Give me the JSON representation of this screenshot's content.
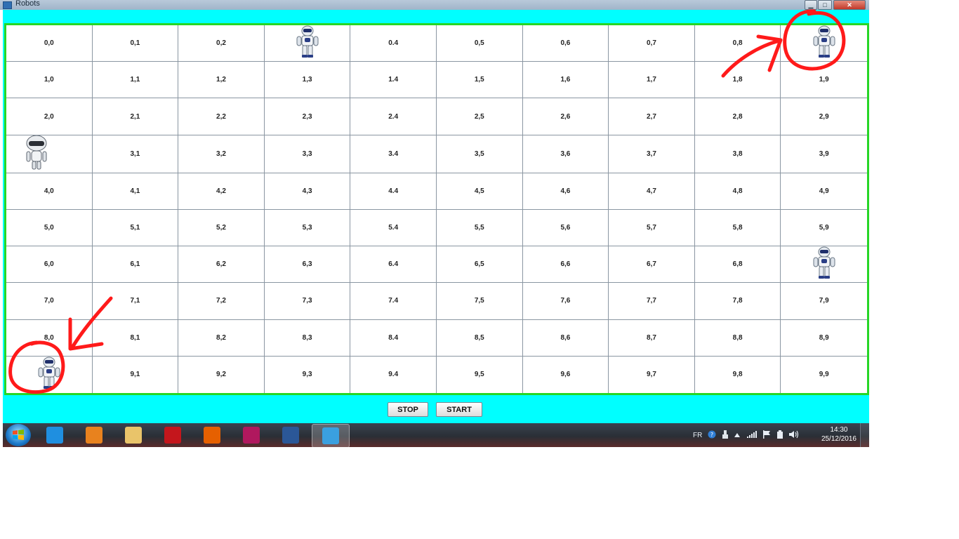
{
  "window": {
    "title": "Robots",
    "minimize_glyph": "▁",
    "maximize_glyph": "□",
    "close_glyph": "✕"
  },
  "grid": {
    "rows": 10,
    "cols": 10,
    "cells": [
      [
        "0,0",
        "0,1",
        "0,2",
        "",
        "0.4",
        "0,5",
        "0,6",
        "0,7",
        "0,8",
        ""
      ],
      [
        "1,0",
        "1,1",
        "1,2",
        "1,3",
        "1.4",
        "1,5",
        "1,6",
        "1,7",
        "1,8",
        "1,9"
      ],
      [
        "2,0",
        "2,1",
        "2,2",
        "2,3",
        "2.4",
        "2,5",
        "2,6",
        "2,7",
        "2,8",
        "2,9"
      ],
      [
        "",
        "3,1",
        "3,2",
        "3,3",
        "3.4",
        "3,5",
        "3,6",
        "3,7",
        "3,8",
        "3,9"
      ],
      [
        "4,0",
        "4,1",
        "4,2",
        "4,3",
        "4.4",
        "4,5",
        "4,6",
        "4,7",
        "4,8",
        "4,9"
      ],
      [
        "5,0",
        "5,1",
        "5,2",
        "5,3",
        "5.4",
        "5,5",
        "5,6",
        "5,7",
        "5,8",
        "5,9"
      ],
      [
        "6,0",
        "6,1",
        "6,2",
        "6,3",
        "6.4",
        "6,5",
        "6,6",
        "6,7",
        "6,8",
        ""
      ],
      [
        "7,0",
        "7,1",
        "7,2",
        "7,3",
        "7.4",
        "7,5",
        "7,6",
        "7,7",
        "7,8",
        "7,9"
      ],
      [
        "8,0",
        "8,1",
        "8,2",
        "8,3",
        "8.4",
        "8,5",
        "8,6",
        "8,7",
        "8,8",
        "8,9"
      ],
      [
        "",
        "9,1",
        "9,2",
        "9,3",
        "9.4",
        "9,5",
        "9,6",
        "9,7",
        "9,8",
        "9,9"
      ]
    ],
    "robots": [
      {
        "row": 0,
        "col": 3,
        "kind": "humanoid-robot-icon"
      },
      {
        "row": 0,
        "col": 9,
        "kind": "humanoid-robot-icon"
      },
      {
        "row": 3,
        "col": 0,
        "kind": "white-robot-icon"
      },
      {
        "row": 6,
        "col": 9,
        "kind": "humanoid-robot-icon"
      },
      {
        "row": 9,
        "col": 0,
        "kind": "humanoid-robot-icon"
      }
    ],
    "border_color": "#26d626"
  },
  "controls": {
    "stop_label": "STOP",
    "start_label": "START"
  },
  "taskbar": {
    "apps": [
      {
        "name": "internet-explorer-icon",
        "color": "#1f8fe0"
      },
      {
        "name": "media-player-icon",
        "color": "#e8821e"
      },
      {
        "name": "file-explorer-icon",
        "color": "#e9c46a"
      },
      {
        "name": "acrobat-icon",
        "color": "#c4161c"
      },
      {
        "name": "firefox-icon",
        "color": "#e66000"
      },
      {
        "name": "intellij-icon",
        "color": "#b0185e"
      },
      {
        "name": "word-icon",
        "color": "#2b5797"
      },
      {
        "name": "java-app-icon",
        "color": "#3aa0e0"
      }
    ],
    "language": "FR",
    "time": "14:30",
    "date": "25/12/2016"
  },
  "colors": {
    "app_background": "#00ffff",
    "annotation_red": "#ff1a1a"
  }
}
